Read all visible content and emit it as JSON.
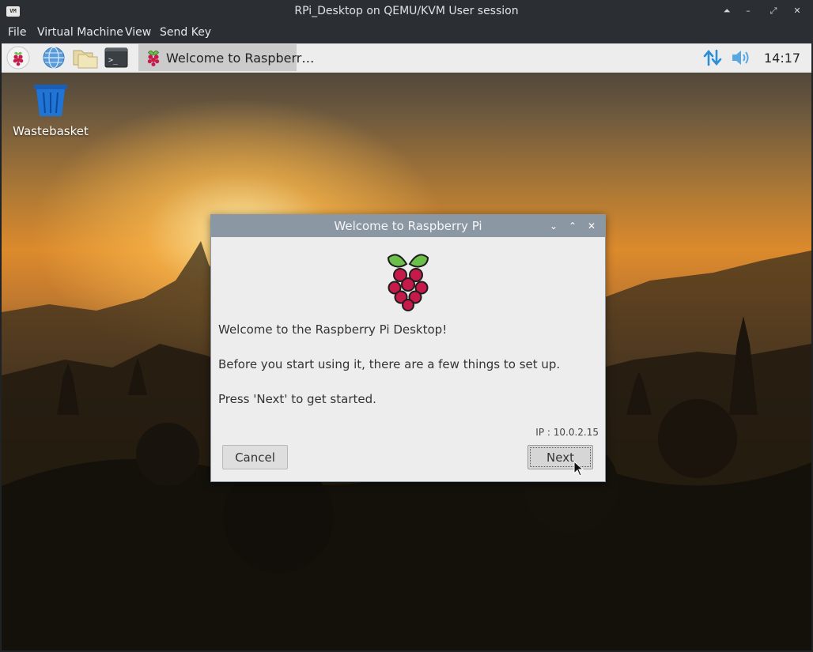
{
  "host_window": {
    "app_icon_text": "VM",
    "title": "RPi_Desktop on QEMU/KVM User session",
    "controls": {
      "up": "⏶",
      "minimize": "–",
      "restore": "⤢",
      "close": "✕"
    },
    "menu": [
      "File",
      "Virtual Machine",
      "View",
      "Send Key"
    ]
  },
  "taskbar": {
    "launchers": [
      "raspberry-menu-icon",
      "web-browser-icon",
      "file-manager-icon",
      "terminal-icon"
    ],
    "terminal_glyph": ">_",
    "active_task": {
      "label": "Welcome to Raspberr…",
      "icon": "raspberry-icon"
    },
    "tray": {
      "network_icon": "network-arrows-icon",
      "volume_icon": "volume-icon"
    },
    "clock": "14:17"
  },
  "desktop": {
    "icons": [
      {
        "label": "Wastebasket",
        "icon": "trash-icon"
      }
    ]
  },
  "dialog": {
    "title": "Welcome to Raspberry Pi",
    "controls": {
      "minimize": "⌄",
      "maximize": "⌃",
      "close": "✕"
    },
    "heading": "Welcome to the Raspberry Pi Desktop!",
    "line1": "Before you start using it, there are a few things to set up.",
    "line2": "Press 'Next' to get started.",
    "ip": "IP : 10.0.2.15",
    "cancel_label": "Cancel",
    "next_label": "Next"
  },
  "colors": {
    "raspberry_red": "#c51a4a",
    "leaf_green": "#6cc04a",
    "tray_blue": "#2b8fd6",
    "dialog_titlebar": "#8b97a2"
  }
}
